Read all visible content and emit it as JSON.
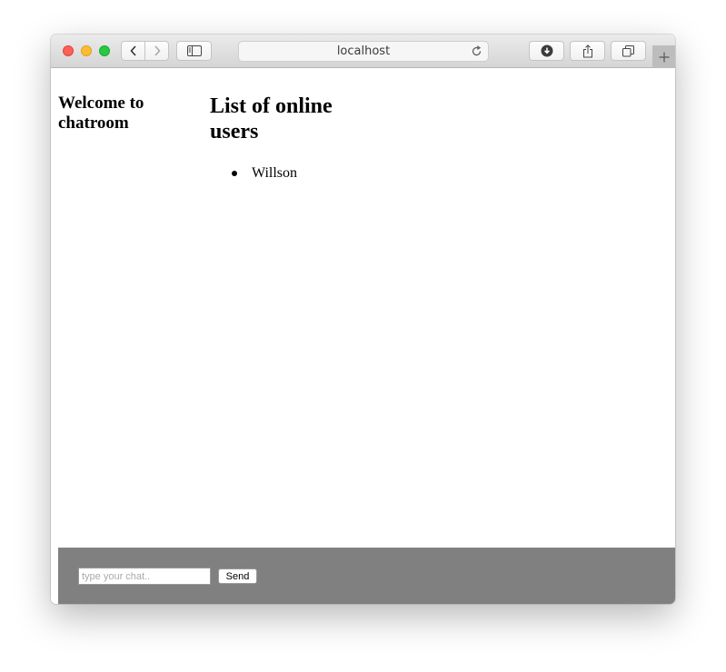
{
  "browser": {
    "address": "localhost",
    "icons": {
      "back": "chevron-left-icon",
      "forward": "chevron-right-icon",
      "sidebar": "sidebar-icon",
      "reload": "reload-icon",
      "download": "download-icon",
      "share": "share-icon",
      "tabs": "tabs-overview-icon",
      "new_tab": "plus-icon"
    }
  },
  "page": {
    "welcome_heading": "Welcome to chatroom",
    "online_heading": "List of online users",
    "users": [
      {
        "name": "Willson"
      }
    ]
  },
  "chat": {
    "placeholder": "type your chat..",
    "value": "",
    "send_label": "Send"
  },
  "colors": {
    "footer_bg": "#808080",
    "close": "#fe5f57",
    "minimize": "#febc2e",
    "maximize": "#28c840"
  }
}
